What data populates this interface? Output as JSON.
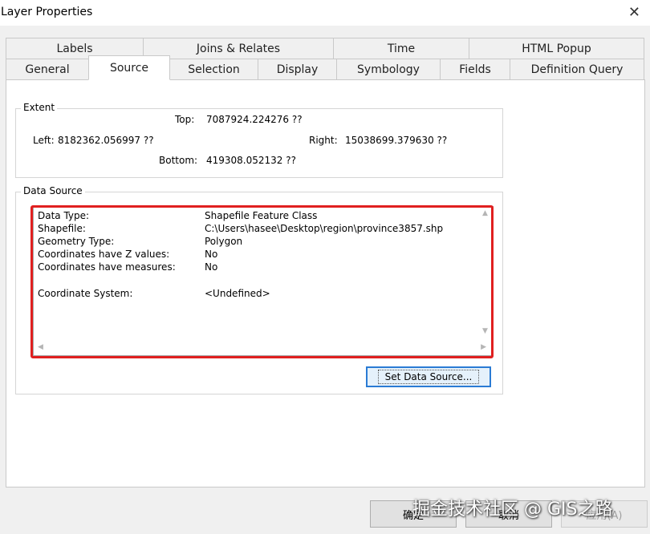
{
  "window": {
    "title": "Layer Properties",
    "close_glyph": "✕"
  },
  "tabs": {
    "row_top": [
      "Labels",
      "Joins & Relates",
      "Time",
      "HTML Popup"
    ],
    "row_bottom": [
      "General",
      "Source",
      "Selection",
      "Display",
      "Symbology",
      "Fields",
      "Definition Query"
    ],
    "active": "Source"
  },
  "extent": {
    "legend": "Extent",
    "top_label": "Top:",
    "top_value": "7087924.224276 ??",
    "left_label": "Left:",
    "left_value": "8182362.056997 ??",
    "right_label": "Right:",
    "right_value": "15038699.379630 ??",
    "bottom_label": "Bottom:",
    "bottom_value": "419308.052132 ??"
  },
  "data_source": {
    "legend": "Data Source",
    "rows": [
      {
        "label": "Data Type:",
        "value": "Shapefile Feature Class"
      },
      {
        "label": "Shapefile:",
        "value": "C:\\Users\\hasee\\Desktop\\region\\province3857.shp"
      },
      {
        "label": "Geometry Type:",
        "value": "Polygon"
      },
      {
        "label": "Coordinates have Z values:",
        "value": "No"
      },
      {
        "label": "Coordinates have measures:",
        "value": "No"
      },
      {
        "label": "Coordinate System:",
        "value": "<Undefined>"
      }
    ],
    "set_button": "Set Data Source..."
  },
  "buttons": {
    "ok": "确定",
    "cancel": "取消",
    "apply": "应用(A)"
  },
  "highlight_color": "#e02020",
  "watermark": "掘金技术社区 @ GIS之路"
}
